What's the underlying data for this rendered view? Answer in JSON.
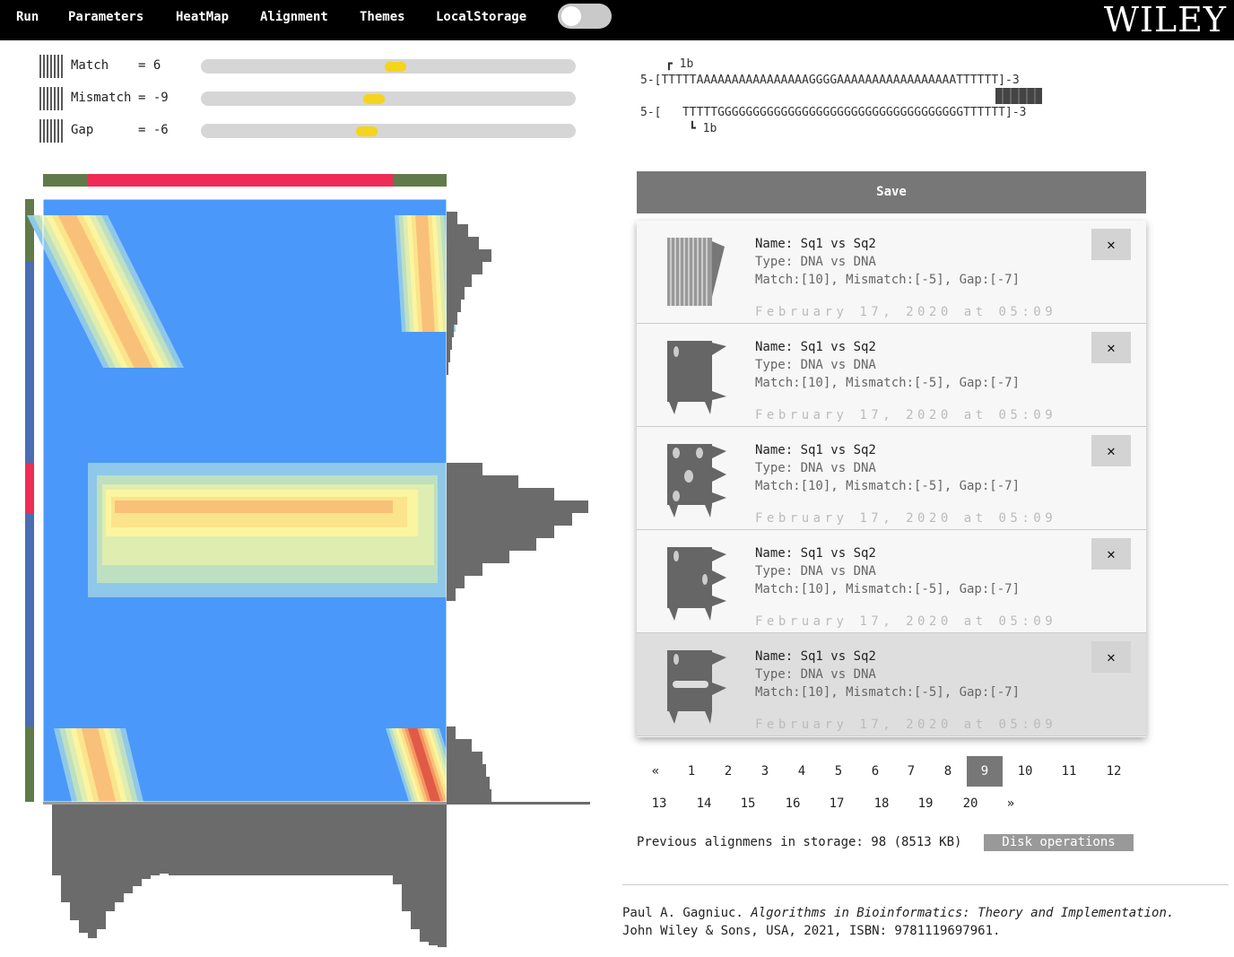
{
  "nav": {
    "items": [
      "Run",
      "Parameters",
      "HeatMap",
      "Alignment",
      "Themes",
      "LocalStorage"
    ],
    "brand": "WILEY"
  },
  "params": [
    {
      "name": "Match",
      "value": "= 6",
      "fraction": 0.52
    },
    {
      "name": "Mismatch",
      "value": "= -9",
      "fraction": 0.46
    },
    {
      "name": "Gap",
      "value": "= -6",
      "fraction": 0.44
    }
  ],
  "alignment": {
    "top_marker": "┏ 1b",
    "seq1": "5-[TTTTTAAAAAAAAAAAAAAAAGGGGAAAAAAAAAAAAAAAAATTTTTT]-3",
    "seq2": "5-[   TTTTTGGGGGGGGGGGGGGGGGGGGGGGGGGGGGGGGGGGTTTTTT]-3",
    "bottom_marker": "┗ 1b"
  },
  "save_label": "Save",
  "records": [
    {
      "name": "Name: Sq1 vs Sq2",
      "type": "Type: DNA vs DNA",
      "params": "Match:[10], Mismatch:[-5], Gap:[-7]",
      "date": "February 17, 2020 at 05:09",
      "del": "✕"
    },
    {
      "name": "Name: Sq1 vs Sq2",
      "type": "Type: DNA vs DNA",
      "params": "Match:[10], Mismatch:[-5], Gap:[-7]",
      "date": "February 17, 2020 at 05:09",
      "del": "✕"
    },
    {
      "name": "Name: Sq1 vs Sq2",
      "type": "Type: DNA vs DNA",
      "params": "Match:[10], Mismatch:[-5], Gap:[-7]",
      "date": "February 17, 2020 at 05:09",
      "del": "✕"
    },
    {
      "name": "Name: Sq1 vs Sq2",
      "type": "Type: DNA vs DNA",
      "params": "Match:[10], Mismatch:[-5], Gap:[-7]",
      "date": "February 17, 2020 at 05:09",
      "del": "✕"
    },
    {
      "name": "Name: Sq1 vs Sq2",
      "type": "Type: DNA vs DNA",
      "params": "Match:[10], Mismatch:[-5], Gap:[-7]",
      "date": "February 17, 2020 at 05:09",
      "del": "✕"
    }
  ],
  "pager": {
    "row1": [
      "«",
      "1",
      "2",
      "3",
      "4",
      "5",
      "6",
      "7",
      "8",
      "9",
      "10",
      "11",
      "12"
    ],
    "row2": [
      "13",
      "14",
      "15",
      "16",
      "17",
      "18",
      "19",
      "20",
      "»"
    ],
    "current": "9"
  },
  "storage": {
    "text": "Previous alignmens in storage: 98 (8513 KB)",
    "button": "Disk operations"
  },
  "citation": {
    "author": "Paul A. Gagniuc. ",
    "title": "Algorithms in Bioinformatics: Theory and Implementation.",
    "line2": "John Wiley & Sons, USA, 2021, ISBN: 9781119697961."
  },
  "colors": {
    "heatmap_bg": "#4a98fa",
    "match_green": "#617a49",
    "mismatch_red": "#ee2c55",
    "seq_blue": "#4a6db3",
    "profile_gray": "#6b6b6b",
    "thumb_yellow": "#f5d41c"
  }
}
